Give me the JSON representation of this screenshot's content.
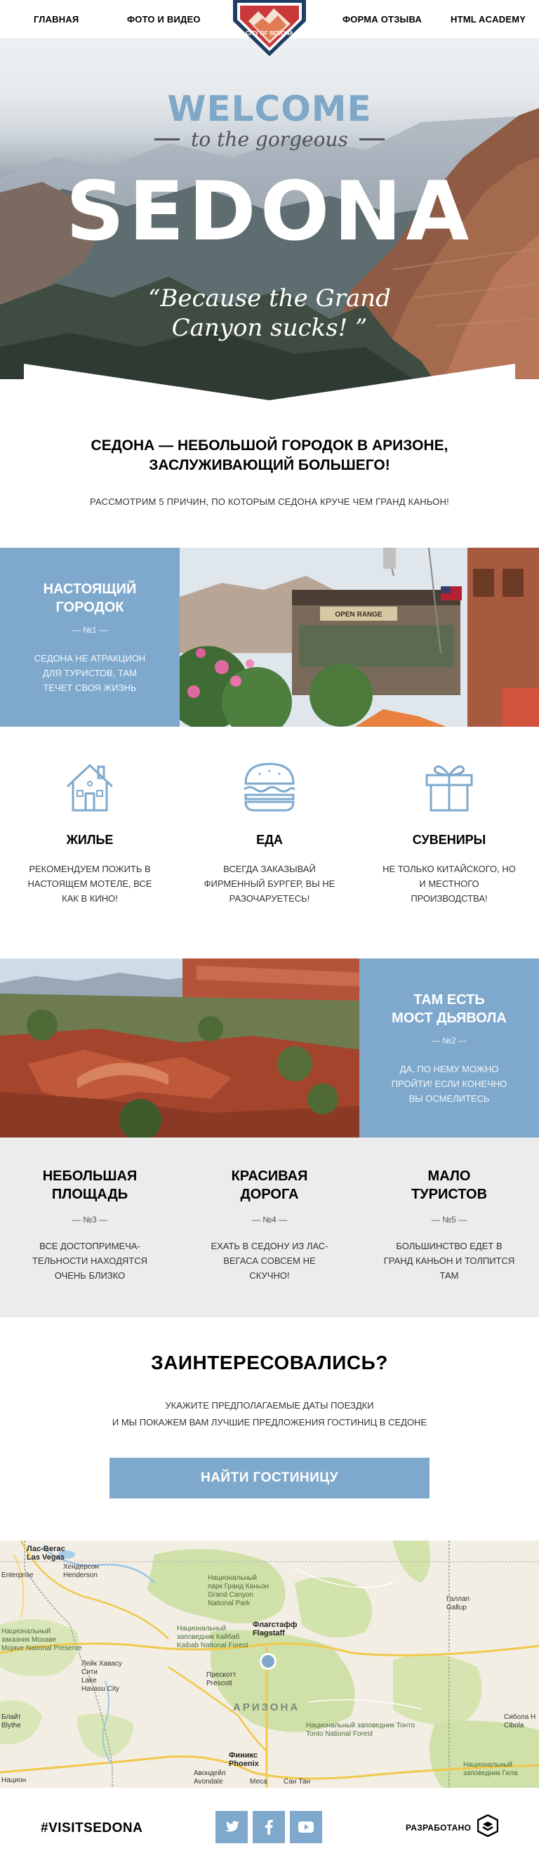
{
  "nav": {
    "home": "ГЛАВНАЯ",
    "photo_video": "ФОТО И ВИДЕО",
    "feedback": "ФОРМА ОТЗЫВА",
    "academy": "HTML ACADEMY",
    "logo_text": "CITY OF SEDONA"
  },
  "hero": {
    "welcome": "WELCOME",
    "subtitle": "to the gorgeous",
    "title": "SEDONA",
    "quote_line1": "“Because the Grand",
    "quote_line2": "Canyon sucks! ”"
  },
  "intro": {
    "title_line1": "СЕДОНА — НЕБОЛЬШОЙ ГОРОДОК В АРИЗОНЕ,",
    "title_line2": "ЗАСЛУЖИВАЮЩИЙ БОЛЬШЕГО!",
    "text": "РАССМОТРИМ 5 ПРИЧИН, ПО КОТОРЫМ СЕДОНА КРУЧЕ ЧЕМ ГРАНД КАНЬОН!"
  },
  "feature1": {
    "title_line1": "НАСТОЯЩИЙ",
    "title_line2": "ГОРОДОК",
    "number": "— №1 —",
    "text": "СЕДОНА НЕ АТРАКЦИОН ДЛЯ ТУРИСТОВ, ТАМ ТЕЧЕТ СВОЯ ЖИЗНЬ",
    "sign_text": "OPEN RANGE"
  },
  "icons": [
    {
      "icon": "house-icon",
      "title": "ЖИЛЬЕ",
      "text": "РЕКОМЕНДУЕМ ПОЖИТЬ В НАСТОЯЩЕМ МОТЕЛЕ, ВСЕ КАК В КИНО!"
    },
    {
      "icon": "burger-icon",
      "title": "ЕДА",
      "text": "ВСЕГДА ЗАКАЗЫВАЙ ФИРМЕННЫЙ БУРГЕР, ВЫ НЕ РАЗОЧАРУЕТЕСЬ!"
    },
    {
      "icon": "gift-icon",
      "title": "СУВЕНИРЫ",
      "text": "НЕ ТОЛЬКО КИТАЙСКОГО, НО И МЕСТНОГО ПРОИЗВОДСТВА!"
    }
  ],
  "feature2": {
    "title_line1": "ТАМ ЕСТЬ",
    "title_line2": "МОСТ ДЬЯВОЛА",
    "number": "— №2 —",
    "text": "ДА, ПО НЕМУ МОЖНО ПРОЙТИ! ЕСЛИ КОНЕЧНО ВЫ ОСМЕЛИТЕСЬ"
  },
  "reasons": [
    {
      "title_line1": "НЕБОЛЬШАЯ",
      "title_line2": "ПЛОЩАДЬ",
      "number": "— №3 —",
      "text": "ВСЕ ДОСТОПРИМЕЧА-ТЕЛЬНОСТИ НАХОДЯТСЯ ОЧЕНЬ БЛИЗКО"
    },
    {
      "title_line1": "КРАСИВАЯ",
      "title_line2": "ДОРОГА",
      "number": "— №4 —",
      "text": "ЕХАТЬ В СЕДОНУ ИЗ ЛАС-ВЕГАСА СОВСЕМ НЕ СКУЧНО!"
    },
    {
      "title_line1": "МАЛО",
      "title_line2": "ТУРИСТОВ",
      "number": "— №5 —",
      "text": "БОЛЬШИНСТВО ЕДЕТ В ГРАНД КАНЬОН И ТОЛПИТСЯ ТАМ"
    }
  ],
  "cta": {
    "title": "ЗАИНТЕРЕСОВАЛИСЬ?",
    "text_line1": "УКАЖИТЕ ПРЕДПОЛАГАЕМЫЕ ДАТЫ ПОЕЗДКИ",
    "text_line2": "И МЫ ПОКАЖЕМ ВАМ ЛУЧШИЕ ПРЕДЛОЖЕНИЯ ГОСТИНИЦ В СЕДОНЕ",
    "button": "НАЙТИ ГОСТИНИЦУ"
  },
  "map": {
    "state": "АРИЗОНА",
    "labels": {
      "las_vegas_ru": "Лас-Вегас",
      "las_vegas_en": "Las Vegas",
      "henderson_ru": "Хендерсон",
      "henderson_en": "Henderson",
      "enterprise": "Enterprise",
      "gc_park_ru1": "Национальный",
      "gc_park_ru2": "парк Гранд Каньон",
      "gc_park_en": "Grand Canyon",
      "gc_park_en2": "National Park",
      "kaibab_ru1": "Национальный",
      "kaibab_ru2": "заповедник Кайбаб",
      "kaibab_en": "Kaibab National Forest",
      "mojave_ru1": "Национальный",
      "mojave_ru2": "заказник Мохаве",
      "mojave_en": "Mojave National Preserve",
      "flagstaff_ru": "Флагстафф",
      "flagstaff_en": "Flagstaff",
      "havasu_ru1": "Лейк Хавасу",
      "havasu_ru2": "Сити",
      "havasu_en1": "Lake",
      "havasu_en2": "Havasu City",
      "prescott_ru": "Прескотт",
      "prescott_en": "Prescott",
      "gallup_ru": "Галлап",
      "gallup_en": "Gallup",
      "tonto_ru": "Национальный заповедник Тонто",
      "tonto_en": "Tonto National Forest",
      "phoenix_ru": "Финикс",
      "phoenix_en": "Phoenix",
      "avondale_ru": "Авондейл",
      "avondale_en": "Avondale",
      "mesa": "Меса",
      "santan": "Сан Тан",
      "gila_ru1": "Национальный",
      "gila_ru2": "заповедник Гила",
      "cibola_ru": "Сибола Н",
      "cibola_en": "Cibola",
      "blythe_ru": "Блайт",
      "blythe_en": "Blythe",
      "n_left": "Национ"
    }
  },
  "footer": {
    "hashtag": "#VISITSEDONA",
    "developed": "РАЗРАБОТАНО",
    "social": [
      "twitter-icon",
      "facebook-icon",
      "youtube-icon"
    ]
  },
  "colors": {
    "accent": "#7ea9cd",
    "grey_section": "#ececec",
    "map_marker": "#7ea9cd"
  }
}
